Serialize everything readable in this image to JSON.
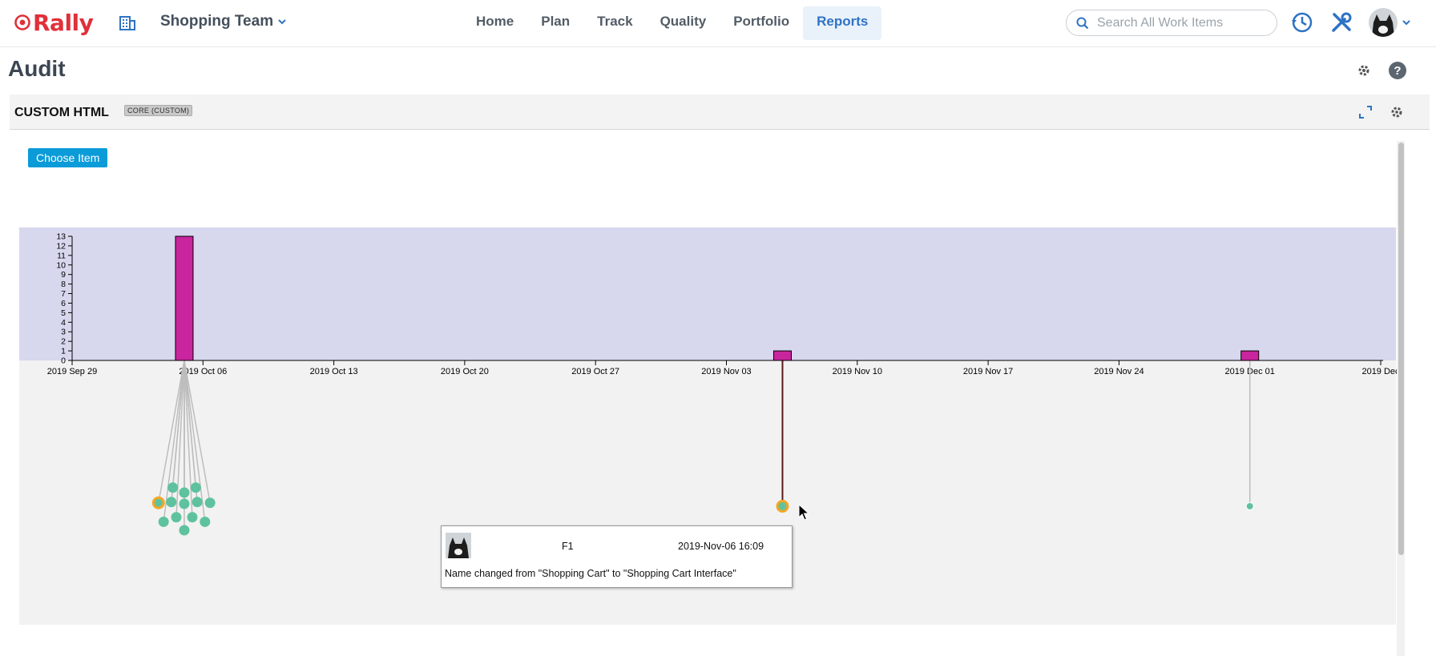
{
  "app": {
    "brand": "Rally",
    "brand_color": "#e0303a",
    "accent": "#2e73c4"
  },
  "header": {
    "team": "Shopping Team",
    "nav": [
      {
        "label": "Home",
        "active": false
      },
      {
        "label": "Plan",
        "active": false
      },
      {
        "label": "Track",
        "active": false
      },
      {
        "label": "Quality",
        "active": false
      },
      {
        "label": "Portfolio",
        "active": false
      },
      {
        "label": "Reports",
        "active": true
      }
    ],
    "search": {
      "placeholder": "Search All Work Items",
      "value": ""
    },
    "icons": [
      "building-icon",
      "clock-history-icon",
      "tools-icon",
      "avatar",
      "chevron-down-icon"
    ]
  },
  "page": {
    "title": "Audit"
  },
  "panel": {
    "title": "CUSTOM HTML",
    "badge": "CORE (CUSTOM)",
    "choose_button": "Choose Item"
  },
  "chart_data": {
    "type": "bar",
    "title": "",
    "xlabel": "",
    "ylabel": "",
    "ylim": [
      0,
      13
    ],
    "y_ticks": [
      "0",
      "1",
      "2",
      "3",
      "4",
      "5",
      "6",
      "7",
      "8",
      "9",
      "10",
      "11",
      "12",
      "13"
    ],
    "x_tick_labels": [
      "2019 Sep 29",
      "2019 Oct 06",
      "2019 Oct 13",
      "2019 Oct 20",
      "2019 Oct 27",
      "2019 Nov 03",
      "2019 Nov 10",
      "2019 Nov 17",
      "2019 Nov 24",
      "2019 Dec 01",
      "2019 Dec"
    ],
    "bars": [
      {
        "date": "2019-10-05",
        "value": 13
      },
      {
        "date": "2019-11-06",
        "value": 1
      },
      {
        "date": "2019-12-01",
        "value": 1
      }
    ],
    "bar_color": "#c9259e",
    "band_color": "#d7d7ee",
    "events": [
      {
        "group": 0,
        "count": 13,
        "highlighted": 1
      },
      {
        "group": 1,
        "count": 1,
        "highlighted": 0
      },
      {
        "group": 2,
        "count": 1,
        "highlighted": -1
      }
    ]
  },
  "tooltip": {
    "item": "F1",
    "date": "2019-Nov-06 16:09",
    "message": "Name changed from \"Shopping Cart\" to \"Shopping Cart Interface\""
  }
}
